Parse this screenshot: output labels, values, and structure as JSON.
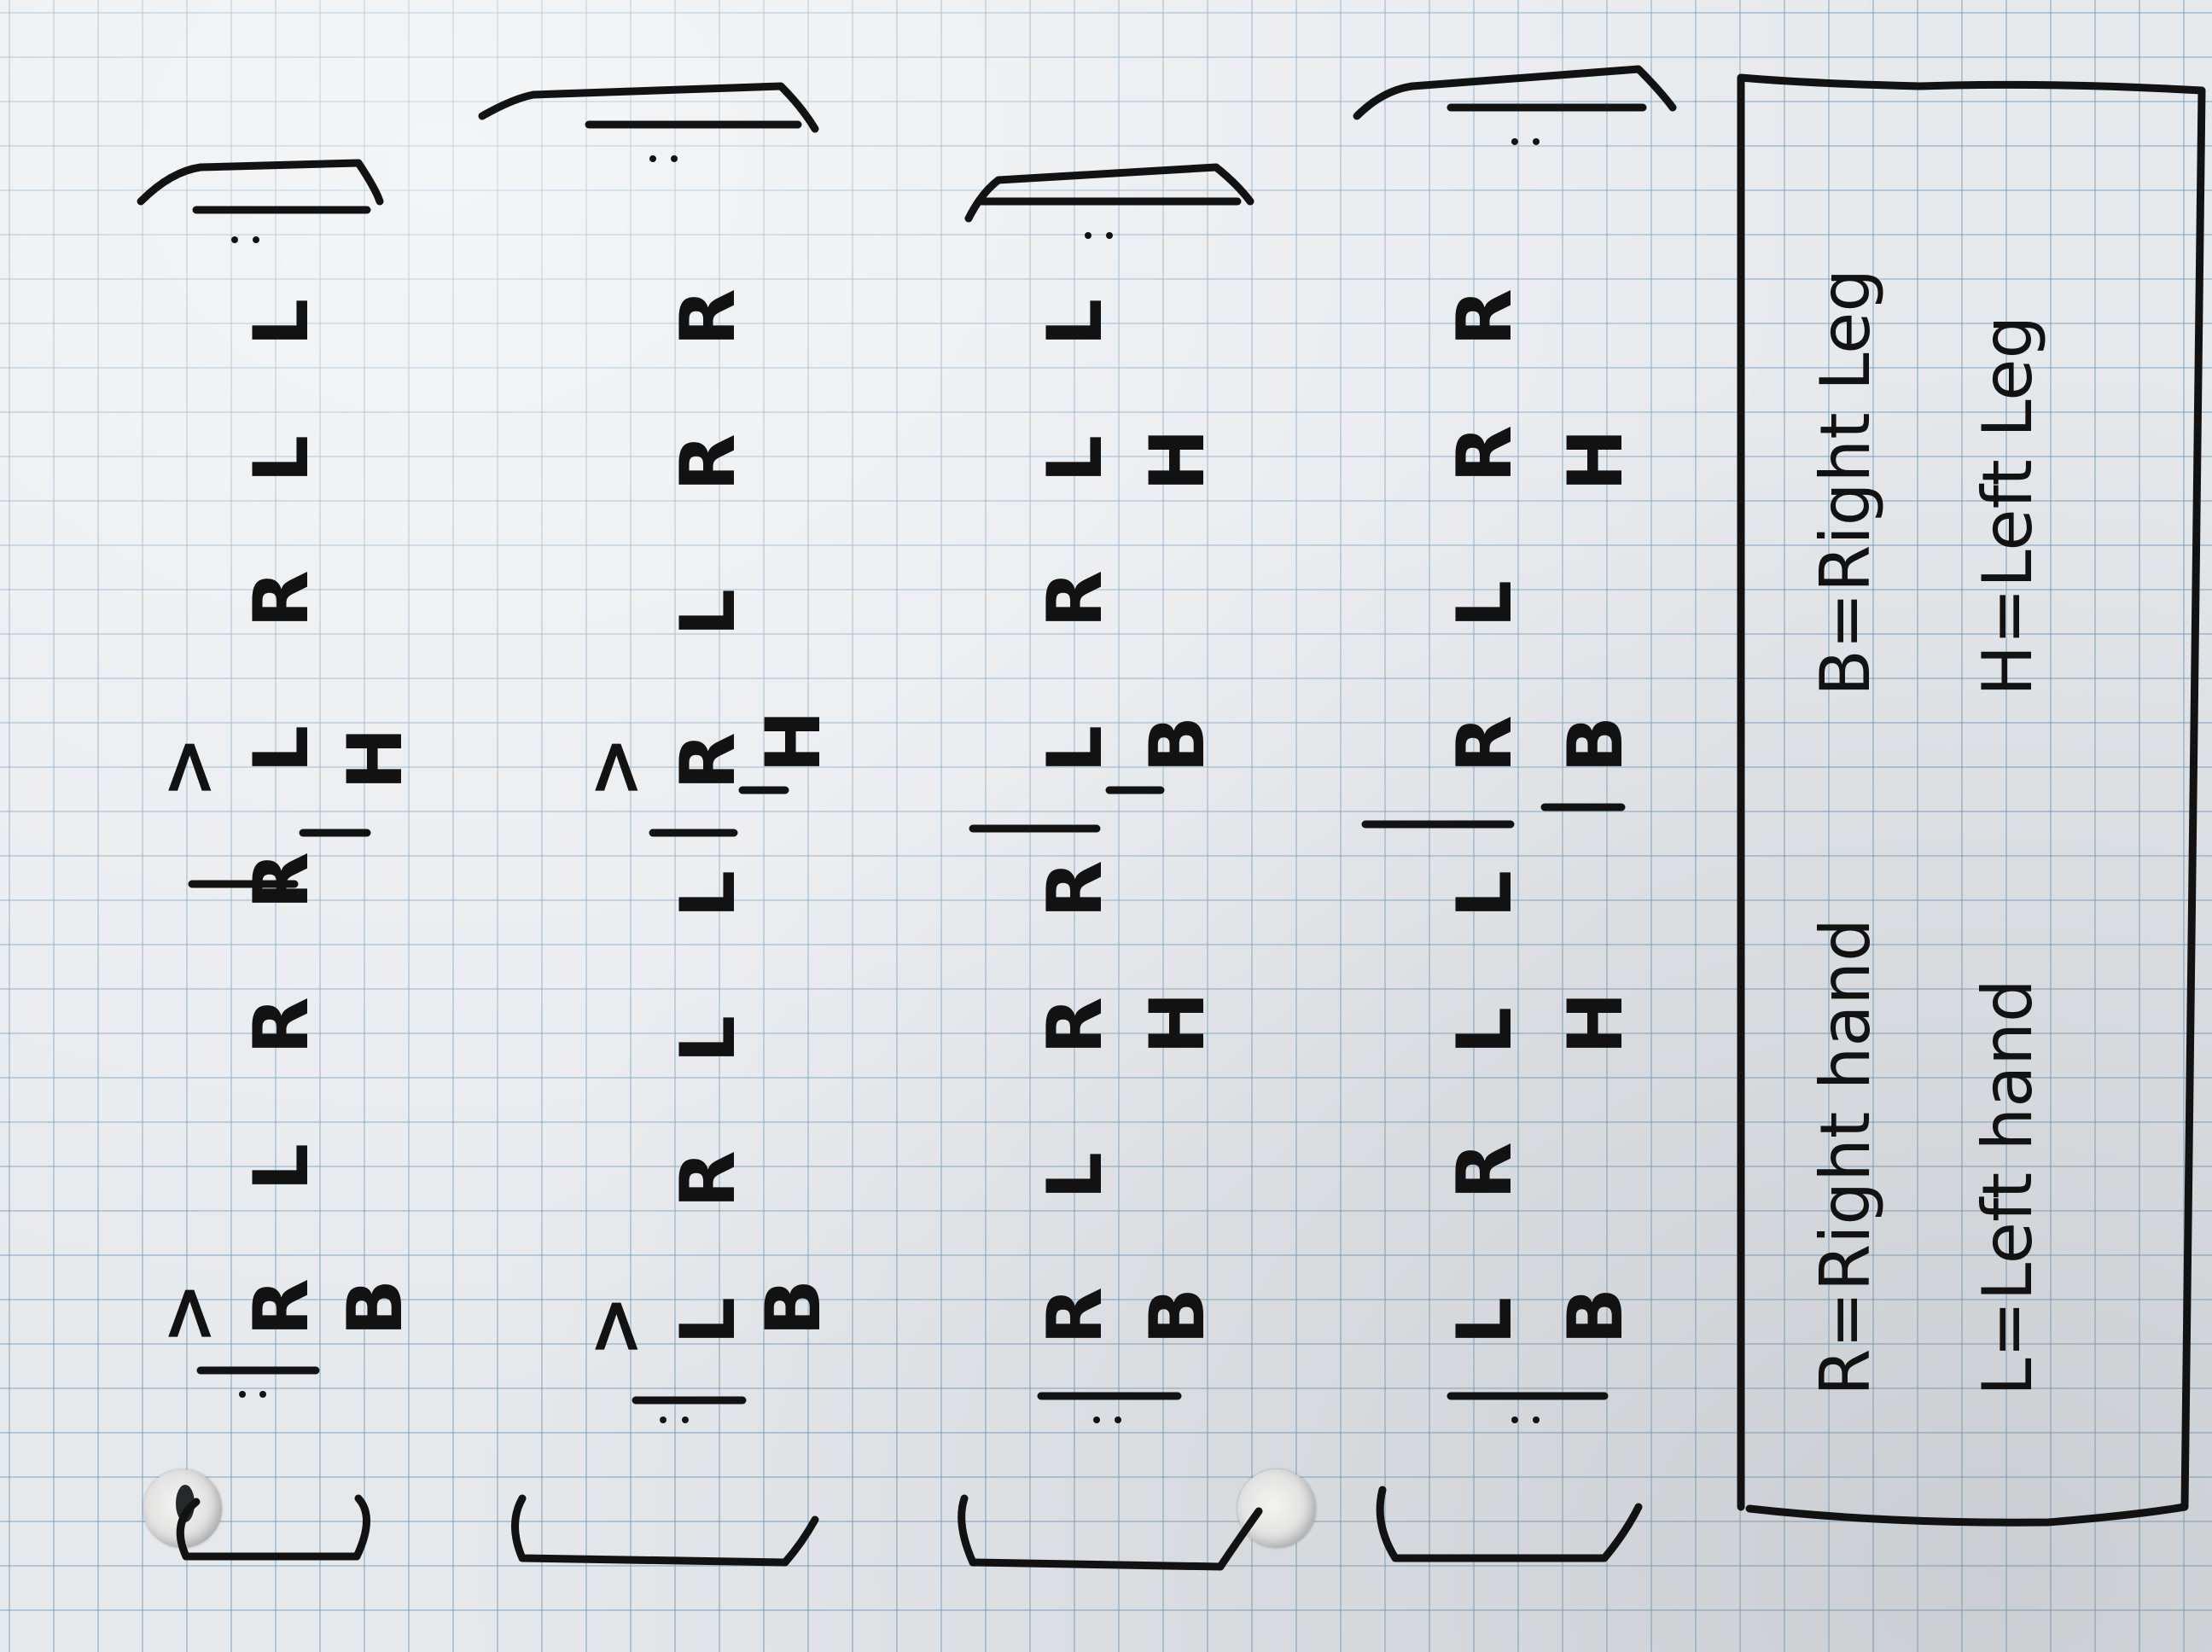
{
  "rows": [
    {
      "stick": [
        "R",
        "L",
        "R",
        "R",
        "L",
        "R",
        "L",
        "L"
      ],
      "accent1": ">",
      "accent2": ">",
      "limb1": "B",
      "limb2": "H"
    },
    {
      "stick": [
        "L",
        "R",
        "L",
        "L",
        "R",
        "L",
        "R",
        "R"
      ],
      "accent1": ">",
      "accent2": ">",
      "limb1": "B",
      "limb2": "H"
    },
    {
      "stick": [
        "R",
        "L",
        "R",
        "R",
        "L",
        "R",
        "L",
        "L"
      ],
      "limb1": "B",
      "limb2": "H",
      "limb3": "B",
      "limb4": "H"
    },
    {
      "stick": [
        "L",
        "R",
        "L",
        "L",
        "R",
        "L",
        "R",
        "R"
      ],
      "limb1": "B",
      "limb2": "H",
      "limb3": "B",
      "limb4": "H"
    }
  ],
  "legend": {
    "right_hand": "R=Right hand",
    "left_hand": "L=Left hand",
    "right_leg": "B=Right Leg",
    "left_leg": "H=Left Leg"
  },
  "colors": {
    "ink": "#121212",
    "grid": "#5c8cb0",
    "paper": "#e6e9ec"
  }
}
